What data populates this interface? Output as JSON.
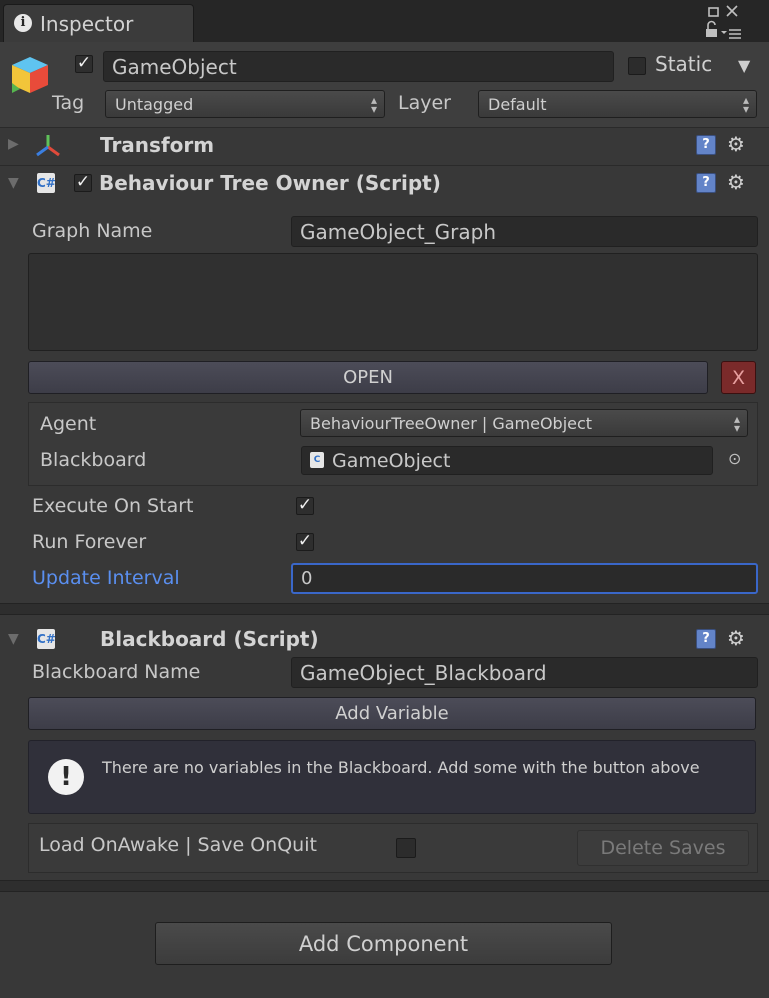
{
  "window": {
    "tab_title": "Inspector",
    "tab_icon": "info-icon",
    "controls": [
      "dock-icon",
      "close-icon",
      "lock-icon",
      "menu-icon"
    ]
  },
  "gameobject": {
    "icon": "cube-icon",
    "active": true,
    "name": "GameObject",
    "static_label": "Static",
    "static_checked": false,
    "tag_label": "Tag",
    "tag_value": "Untagged",
    "layer_label": "Layer",
    "layer_value": "Default"
  },
  "transform": {
    "title": "Transform",
    "icon": "transform-axes-icon",
    "expanded": false
  },
  "bt_owner": {
    "title": "Behaviour Tree Owner (Script)",
    "enabled": true,
    "expanded": true,
    "graph_name_label": "Graph Name",
    "graph_name_value": "GameObject_Graph",
    "open_label": "OPEN",
    "remove_label": "X",
    "agent_label": "Agent",
    "agent_value": "BehaviourTreeOwner | GameObject",
    "blackboard_label": "Blackboard",
    "blackboard_value": "GameObject",
    "execute_on_start_label": "Execute On Start",
    "execute_on_start": true,
    "run_forever_label": "Run Forever",
    "run_forever": true,
    "update_interval_label": "Update Interval",
    "update_interval_value": "0"
  },
  "blackboard": {
    "title": "Blackboard (Script)",
    "expanded": true,
    "name_label": "Blackboard Name",
    "name_value": "GameObject_Blackboard",
    "add_variable_label": "Add Variable",
    "info_message": "There are no variables in the Blackboard. Add some with the button above",
    "load_save_label": "Load OnAwake | Save OnQuit",
    "load_save_checked": false,
    "delete_saves_label": "Delete Saves"
  },
  "add_component_label": "Add Component",
  "colors": {
    "panel": "#383838",
    "header_bar": "#262626",
    "field": "#2a2a2a",
    "focus_border": "#3a67c9",
    "focus_label": "#5a8ff0",
    "remove_button": "#8a2a2a"
  }
}
